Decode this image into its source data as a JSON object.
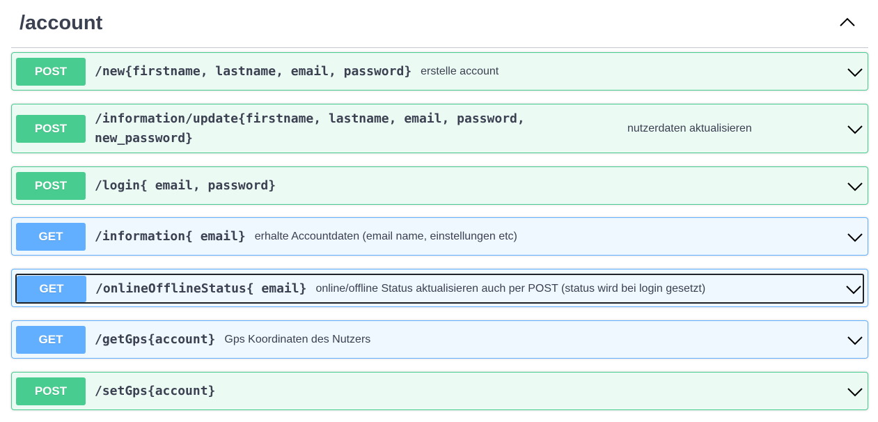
{
  "section": {
    "title": "/account"
  },
  "operations": [
    {
      "method": "POST",
      "path": "/new{firstname, lastname, email, password}",
      "description": "erstelle account"
    },
    {
      "method": "POST",
      "path": "/information/update{firstname, lastname, email, password, new_password}",
      "description": "nutzerdaten aktualisieren"
    },
    {
      "method": "POST",
      "path": "/login{ email, password}",
      "description": ""
    },
    {
      "method": "GET",
      "path": "/information{ email}",
      "description": "erhalte Accountdaten (email name, einstellungen etc)"
    },
    {
      "method": "GET",
      "path": "/onlineOfflineStatus{ email}",
      "description": "online/offline Status aktualisieren auch per POST (status wird bei login gesetzt)"
    },
    {
      "method": "GET",
      "path": "/getGps{account}",
      "description": "Gps Koordinaten des Nutzers"
    },
    {
      "method": "POST",
      "path": "/setGps{account}",
      "description": ""
    }
  ],
  "colors": {
    "post": "#49cc90",
    "get": "#61affe",
    "text": "#3b4151"
  },
  "icons": {
    "section_toggle": "chevron-up-icon",
    "operation_toggle": "chevron-down-icon"
  }
}
